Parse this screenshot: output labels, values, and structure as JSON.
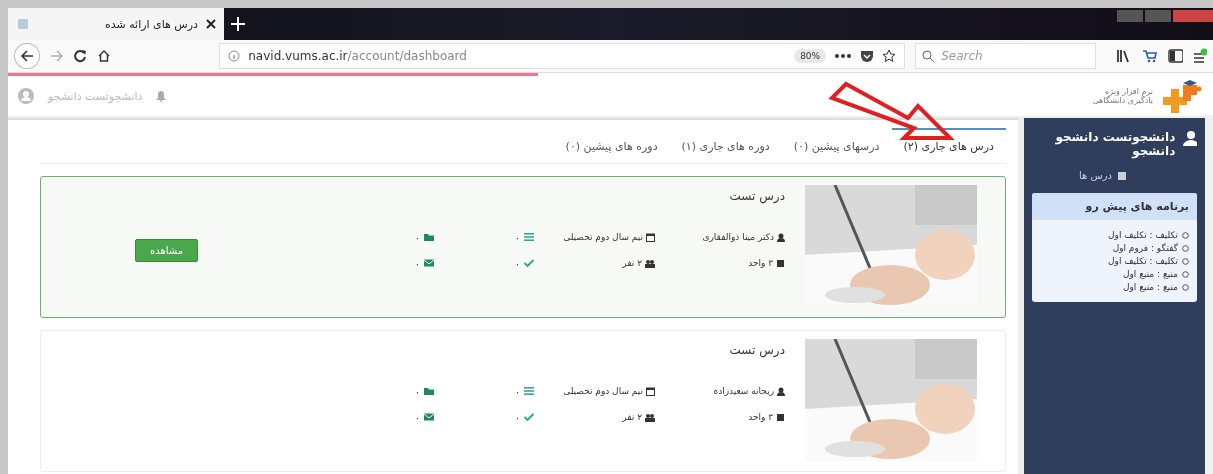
{
  "browser": {
    "tab_title": "درس های ارائه شده",
    "url_host": "navid.vums.ac.ir",
    "url_path": "/account/dashboard",
    "zoom": "80%",
    "search_placeholder": "Search",
    "page_load": {
      "level": 0.44
    }
  },
  "header": {
    "user_name": "دانشجوتست دانشجو",
    "logo_lines": [
      "نرم افزار ویژه",
      "یادگیری دانشگاهی"
    ]
  },
  "tabs": [
    {
      "label": "درس های جاری (۲)",
      "selected": true
    },
    {
      "label": "درسهای پیشین (۰)",
      "selected": false
    },
    {
      "label": "دوره های جاری (۱)",
      "selected": false
    },
    {
      "label": "دوره های پیشین (۰)",
      "selected": false
    }
  ],
  "courses": [
    {
      "title": "درس تست",
      "teacher": "دکتر مینا ذوالفقاری",
      "units": "۳ واحد",
      "semester": "نیم سال دوم تحصیلی",
      "students": "۲ نفر",
      "counters": [
        {
          "kind": "list",
          "value": "۰"
        },
        {
          "kind": "folder",
          "value": "۰"
        },
        {
          "kind": "check",
          "value": "۰"
        },
        {
          "kind": "mail",
          "value": "۰"
        }
      ],
      "button": "مشاهده",
      "selected": true
    },
    {
      "title": "درس تست",
      "teacher": "ریحانه سعیدزاده",
      "units": "۳ واحد",
      "semester": "نیم سال دوم تحصیلی",
      "students": "۲ نفر",
      "counters": [
        {
          "kind": "list",
          "value": "۰"
        },
        {
          "kind": "folder",
          "value": "۰"
        },
        {
          "kind": "check",
          "value": "۰"
        },
        {
          "kind": "mail",
          "value": "۰"
        }
      ],
      "selected": false
    }
  ],
  "sidebar": {
    "user_name": "دانشجوتست دانشجو دانشجو",
    "menu": [
      {
        "label": "درس ها"
      }
    ],
    "upcoming": {
      "title": "برنامه های پیش رو",
      "items": [
        "تکلیف : تکلیف اول",
        "گفتگو : فروم اول",
        "تکلیف : تکلیف اول",
        "منبع : منبع اول",
        "منبع : منبع اول"
      ]
    }
  }
}
